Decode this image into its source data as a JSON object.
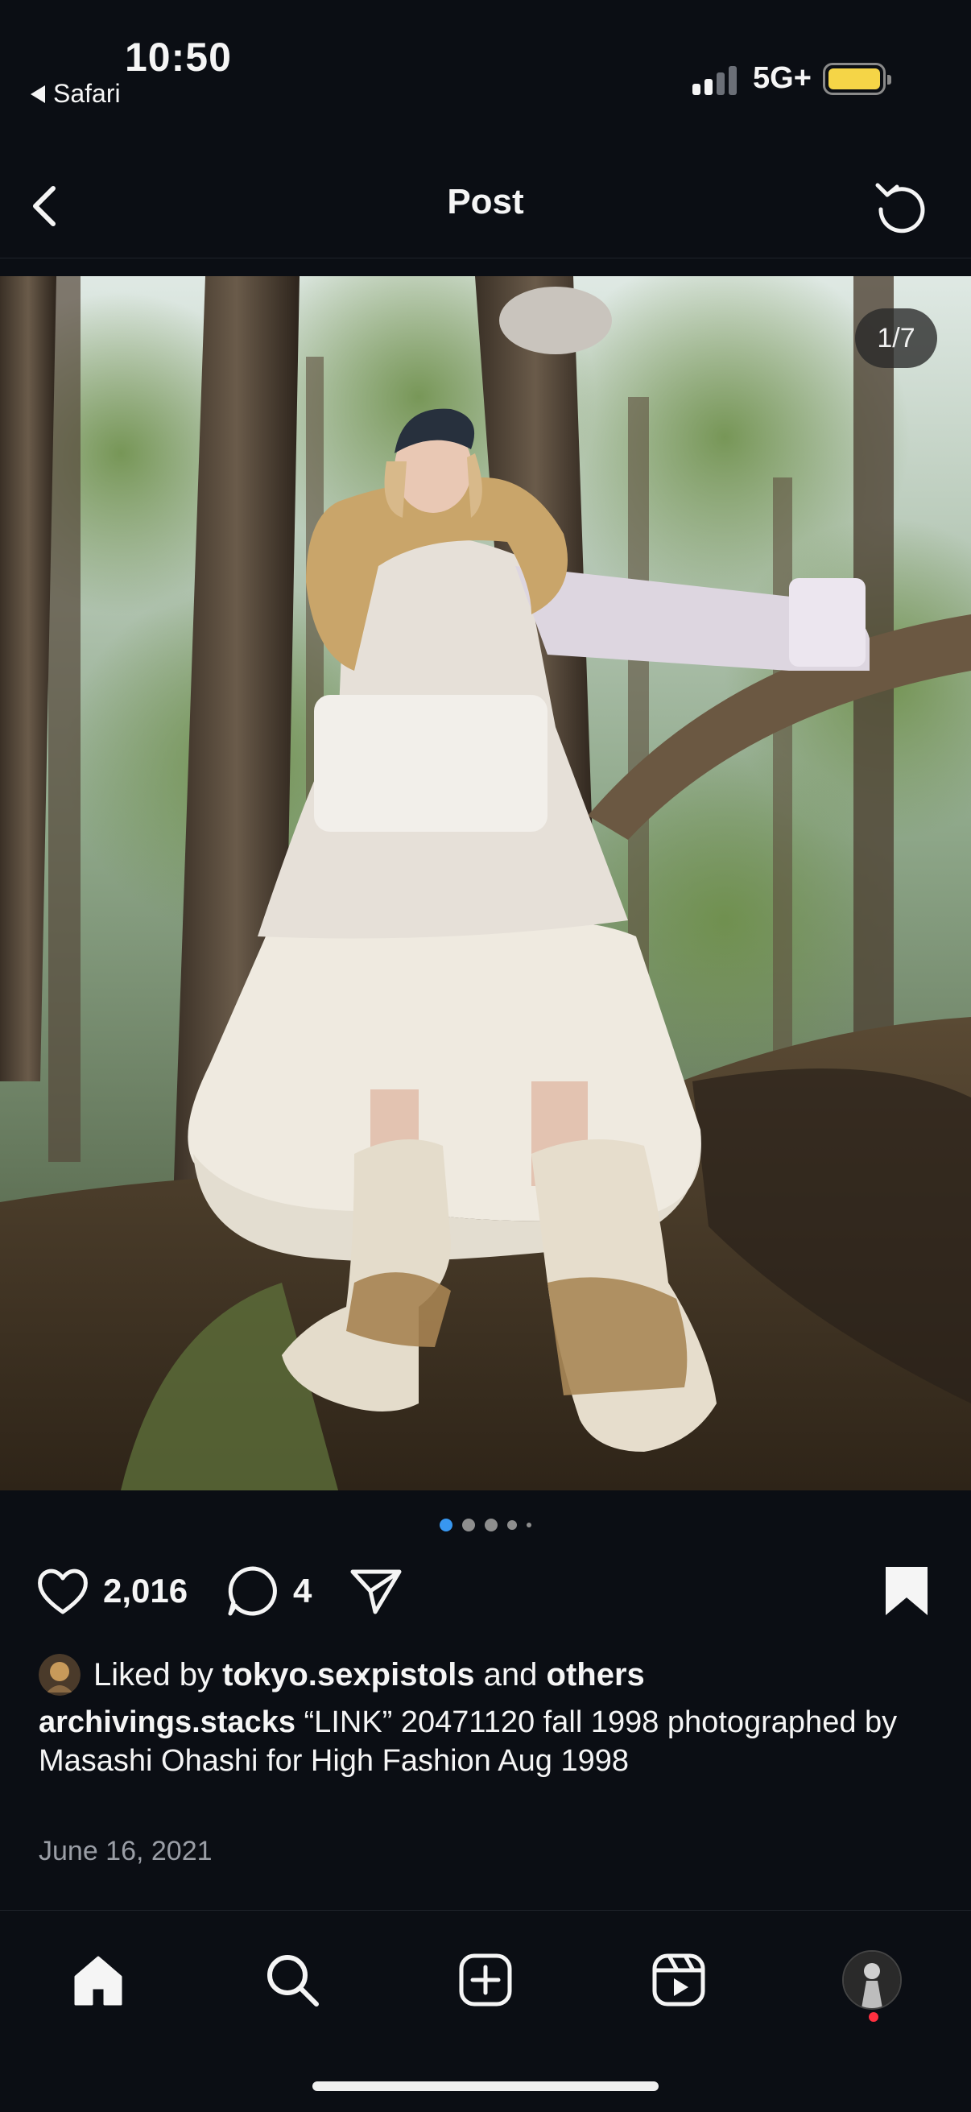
{
  "status_bar": {
    "time": "10:50",
    "back_app": "Safari",
    "network": "5G+",
    "battery_color": "#f5d547"
  },
  "header": {
    "title": "Post",
    "back_icon": "chevron-left-icon",
    "refresh_icon": "refresh-icon"
  },
  "post": {
    "image_counter": "1/7",
    "carousel": {
      "total": 7,
      "active": 1
    },
    "likes_count": "2,016",
    "comments_count": "4",
    "liked_by_prefix": "Liked by",
    "liked_by_user": "tokyo.sexpistols",
    "liked_by_and": "and",
    "liked_by_others": "others",
    "author": "archivings.stacks",
    "caption_text": "“LINK” 20471120 fall 1998 photographed by Masashi Ohashi for High Fashion Aug 1998",
    "date": "June 16, 2021",
    "accent_color": "#3897f0"
  },
  "nav": {
    "items": [
      "home-icon",
      "search-icon",
      "create-icon",
      "reels-icon",
      "profile-avatar"
    ],
    "notification_color": "#ff3040"
  }
}
